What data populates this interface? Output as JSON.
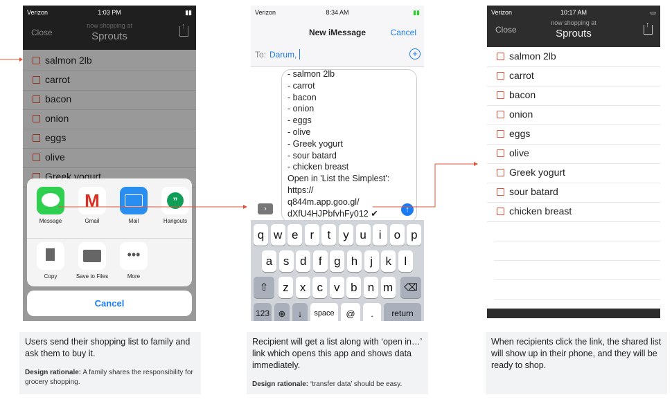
{
  "phone1": {
    "status": {
      "carrier": "Verizon",
      "time": "1:03 PM"
    },
    "header": {
      "close": "Close",
      "subtitle": "now shopping at",
      "store": "Sprouts"
    },
    "items": [
      "salmon 2lb",
      "carrot",
      "bacon",
      "onion",
      "eggs",
      "olive",
      "Greek yogurt"
    ],
    "share_apps": [
      "Message",
      "Gmail",
      "Mail",
      "Hangouts"
    ],
    "share_actions": [
      "Copy",
      "Save to Files",
      "More"
    ],
    "cancel": "Cancel"
  },
  "phone2": {
    "status": {
      "carrier": "Verizon",
      "time": "8:34 AM"
    },
    "header": {
      "title": "New iMessage",
      "cancel": "Cancel"
    },
    "to_label": "To:",
    "recipient": "Darum,",
    "message_lines": [
      "- salmon 2lb",
      "- carrot",
      "- bacon",
      "- onion",
      "- eggs",
      "- olive",
      "- Greek yogurt",
      "- sour batard",
      "- chicken breast",
      "Open in 'List the Simplest':",
      "https://",
      "q844m.app.goo.gl/",
      "dXfU4HJPbfvhFy012 ✔"
    ],
    "keyboard": {
      "row1": [
        "q",
        "w",
        "e",
        "r",
        "t",
        "y",
        "u",
        "i",
        "o",
        "p"
      ],
      "row2": [
        "a",
        "s",
        "d",
        "f",
        "g",
        "h",
        "j",
        "k",
        "l"
      ],
      "row3": [
        "z",
        "x",
        "c",
        "v",
        "b",
        "n",
        "m"
      ],
      "num": "123",
      "space": "space",
      "at": "@",
      "dot": ".",
      "return": "return"
    }
  },
  "phone3": {
    "status": {
      "carrier": "Verizon",
      "time": "10:17 AM"
    },
    "header": {
      "close": "Close",
      "subtitle": "now shopping at",
      "store": "Sprouts"
    },
    "items": [
      "salmon 2lb",
      "carrot",
      "bacon",
      "onion",
      "eggs",
      "olive",
      "Greek yogurt",
      "sour batard",
      "chicken breast"
    ]
  },
  "captions": {
    "c1": {
      "text": "Users send their shopping list to family and ask them to buy it.",
      "rationale_label": "Design rationale:",
      "rationale": " A family shares the responsibility for grocery shopping."
    },
    "c2": {
      "text": "Recipient will get a list along with ‘open in…’ link which opens this app and shows data immediately.",
      "rationale_label": "Design rationale:",
      "rationale": " ‘transfer data’ should be easy."
    },
    "c3": {
      "text": "When recipients click the link, the shared list will show up in their phone, and they will be ready to shop."
    }
  },
  "colors": {
    "accent_red": "#e0553a",
    "ios_blue": "#1a7cf5",
    "dark_header": "#2d2d2d"
  }
}
